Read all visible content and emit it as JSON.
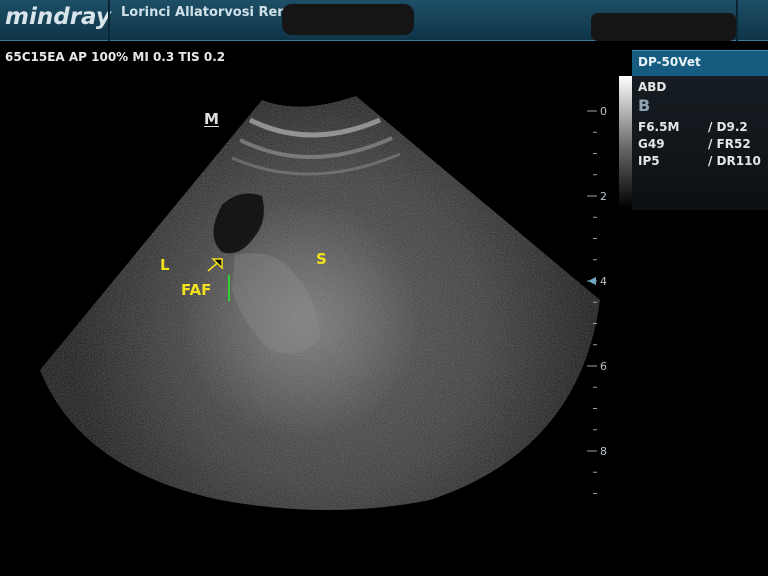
{
  "header": {
    "brand": "mindray",
    "hospital": "Lorinci Allatorvosi Rend..."
  },
  "params": {
    "text": "65C15EA  AP 100%  MI 0.3  TIS 0.2"
  },
  "panel": {
    "probe": "DP-50Vet",
    "exam": "ABD",
    "mode": "B",
    "rows": [
      {
        "left": "F6.5M",
        "right": "/ D9.2"
      },
      {
        "left": "G49",
        "right": "/ FR52"
      },
      {
        "left": "IP5",
        "right": "/ DR110"
      }
    ]
  },
  "image": {
    "orientation_marker": "M",
    "labels": {
      "liver": "L",
      "spleen": "S",
      "faf": "FAF"
    },
    "caliper_color": "#2fd02f",
    "arrow_color": "#f2e11b"
  },
  "depth_scale": {
    "labels": [
      "0",
      "2",
      "4",
      "6",
      "8"
    ],
    "focus_depth_cm": 4,
    "max_depth_cm": 9.2
  }
}
